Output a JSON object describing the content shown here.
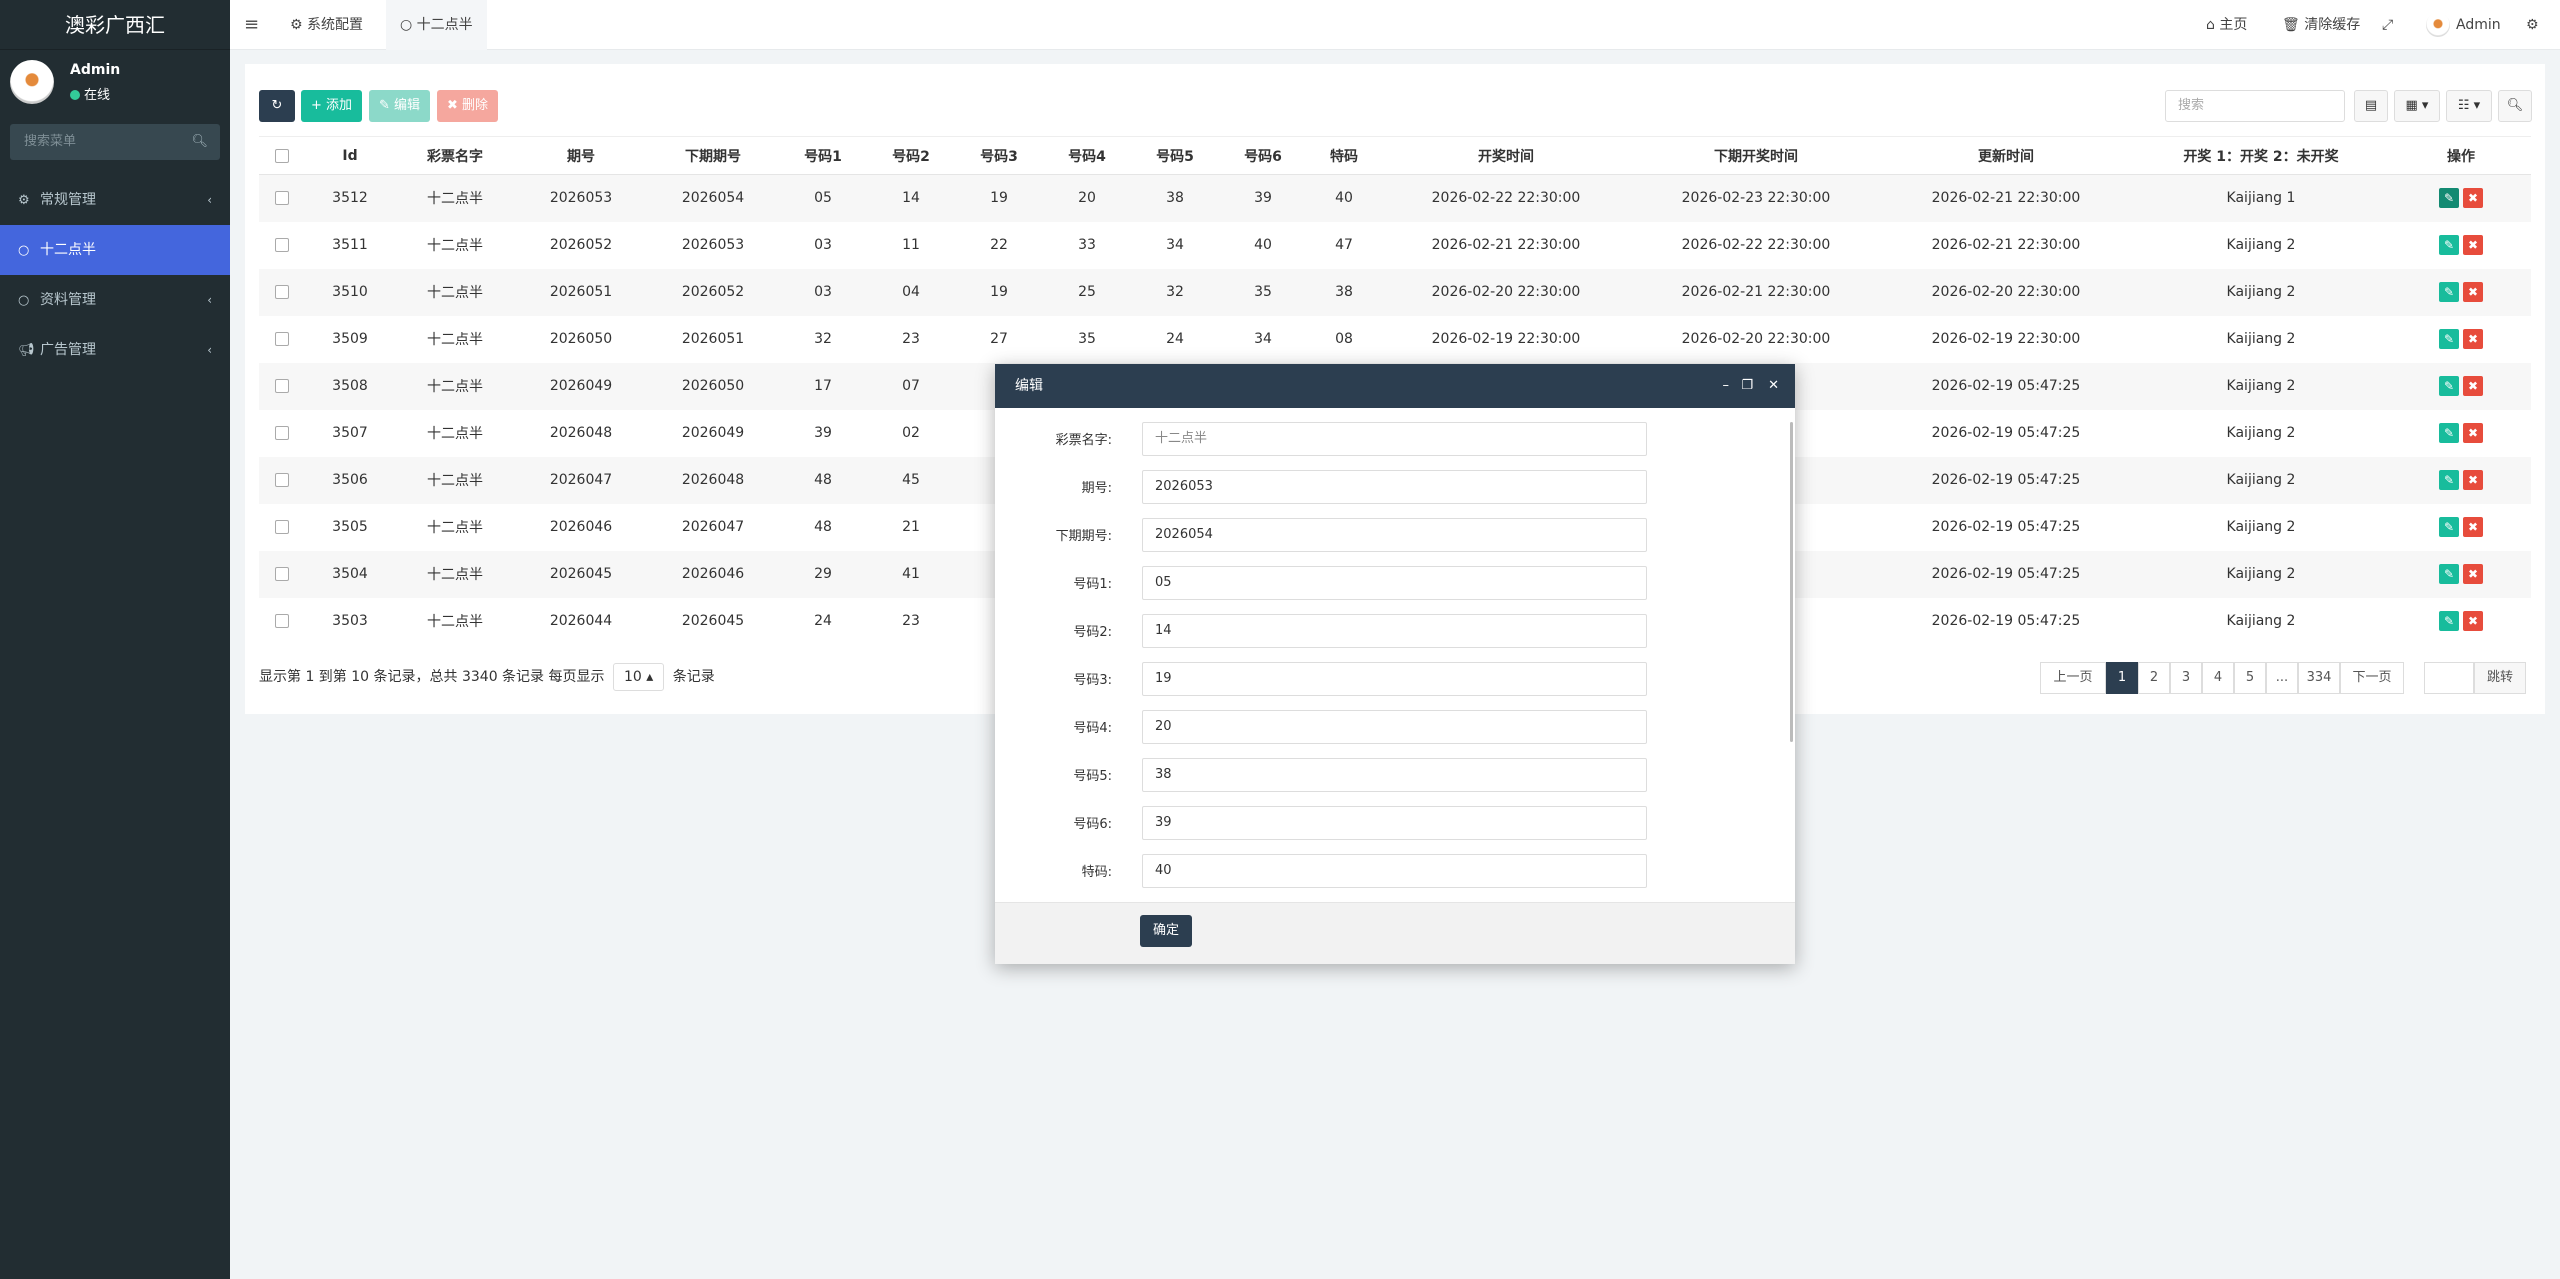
{
  "sidebar": {
    "logo": "澳彩广西汇",
    "user": {
      "name": "Admin",
      "status": "在线"
    },
    "search_placeholder": "搜索菜单",
    "items": [
      {
        "label": "常规管理",
        "icon": "gears-icon",
        "active": false,
        "expandable": true
      },
      {
        "label": "十二点半",
        "icon": "circle-icon",
        "active": true,
        "expandable": false
      },
      {
        "label": "资料管理",
        "icon": "circle-icon",
        "active": false,
        "expandable": true
      },
      {
        "label": "广告管理",
        "icon": "bullhorn-icon",
        "active": false,
        "expandable": true
      }
    ]
  },
  "topbar": {
    "tabs": [
      {
        "label": "系统配置",
        "icon": "gear-icon"
      },
      {
        "label": "十二点半",
        "icon": "circle-icon",
        "active": true
      }
    ],
    "home_label": "主页",
    "clear_cache_label": "清除缓存",
    "user_label": "Admin"
  },
  "toolbar": {
    "add_label": "添加",
    "edit_label": "编辑",
    "delete_label": "删除",
    "search_placeholder": "搜索"
  },
  "table": {
    "headers": [
      "Id",
      "彩票名字",
      "期号",
      "下期期号",
      "号码1",
      "号码2",
      "号码3",
      "号码4",
      "号码5",
      "号码6",
      "特码",
      "开奖时间",
      "下期开奖时间",
      "更新时间",
      "开奖 1：开奖 2：未开奖",
      "操作"
    ],
    "rows": [
      {
        "id": "3512",
        "name": "十二点半",
        "qh": "2026053",
        "next": "2026054",
        "n1": "05",
        "n2": "14",
        "n3": "19",
        "n4": "20",
        "n5": "38",
        "n6": "39",
        "tm": "40",
        "open": "2026-02-22 22:30:00",
        "next_open": "2026-02-23 22:30:00",
        "updated": "2026-02-21 22:30:00",
        "status": "Kaijiang 1"
      },
      {
        "id": "3511",
        "name": "十二点半",
        "qh": "2026052",
        "next": "2026053",
        "n1": "03",
        "n2": "11",
        "n3": "22",
        "n4": "33",
        "n5": "34",
        "n6": "40",
        "tm": "47",
        "open": "2026-02-21 22:30:00",
        "next_open": "2026-02-22 22:30:00",
        "updated": "2026-02-21 22:30:00",
        "status": "Kaijiang 2"
      },
      {
        "id": "3510",
        "name": "十二点半",
        "qh": "2026051",
        "next": "2026052",
        "n1": "03",
        "n2": "04",
        "n3": "19",
        "n4": "25",
        "n5": "32",
        "n6": "35",
        "tm": "38",
        "open": "2026-02-20 22:30:00",
        "next_open": "2026-02-21 22:30:00",
        "updated": "2026-02-20 22:30:00",
        "status": "Kaijiang 2"
      },
      {
        "id": "3509",
        "name": "十二点半",
        "qh": "2026050",
        "next": "2026051",
        "n1": "32",
        "n2": "23",
        "n3": "27",
        "n4": "35",
        "n5": "24",
        "n6": "34",
        "tm": "08",
        "open": "2026-02-19 22:30:00",
        "next_open": "2026-02-20 22:30:00",
        "updated": "2026-02-19 22:30:00",
        "status": "Kaijiang 2"
      },
      {
        "id": "3508",
        "name": "十二点半",
        "qh": "2026049",
        "next": "2026050",
        "n1": "17",
        "n2": "07",
        "n3": "",
        "n4": "",
        "n5": "",
        "n6": "",
        "tm": "",
        "open": "",
        "next_open": "2:30:00",
        "updated": "2026-02-19 05:47:25",
        "status": "Kaijiang 2"
      },
      {
        "id": "3507",
        "name": "十二点半",
        "qh": "2026048",
        "next": "2026049",
        "n1": "39",
        "n2": "02",
        "n3": "",
        "n4": "",
        "n5": "",
        "n6": "",
        "tm": "",
        "open": "",
        "next_open": "2:30:00",
        "updated": "2026-02-19 05:47:25",
        "status": "Kaijiang 2"
      },
      {
        "id": "3506",
        "name": "十二点半",
        "qh": "2026047",
        "next": "2026048",
        "n1": "48",
        "n2": "45",
        "n3": "",
        "n4": "",
        "n5": "",
        "n6": "",
        "tm": "",
        "open": "",
        "next_open": "2:30:00",
        "updated": "2026-02-19 05:47:25",
        "status": "Kaijiang 2"
      },
      {
        "id": "3505",
        "name": "十二点半",
        "qh": "2026046",
        "next": "2026047",
        "n1": "48",
        "n2": "21",
        "n3": "",
        "n4": "",
        "n5": "",
        "n6": "",
        "tm": "",
        "open": "",
        "next_open": "2:30:00",
        "updated": "2026-02-19 05:47:25",
        "status": "Kaijiang 2"
      },
      {
        "id": "3504",
        "name": "十二点半",
        "qh": "2026045",
        "next": "2026046",
        "n1": "29",
        "n2": "41",
        "n3": "",
        "n4": "",
        "n5": "",
        "n6": "",
        "tm": "",
        "open": "",
        "next_open": "2:30:00",
        "updated": "2026-02-19 05:47:25",
        "status": "Kaijiang 2"
      },
      {
        "id": "3503",
        "name": "十二点半",
        "qh": "2026044",
        "next": "2026045",
        "n1": "24",
        "n2": "23",
        "n3": "",
        "n4": "",
        "n5": "",
        "n6": "",
        "tm": "",
        "open": "",
        "next_open": "2:30:00",
        "updated": "2026-02-19 05:47:25",
        "status": "Kaijiang 2"
      }
    ]
  },
  "footer": {
    "info_prefix": "显示第 1 到第 10 条记录，总共 3340 条记录 每页显示",
    "page_size": "10",
    "info_suffix": "条记录"
  },
  "pagination": {
    "prev": "上一页",
    "pages": [
      "1",
      "2",
      "3",
      "4",
      "5",
      "...",
      "334"
    ],
    "active_page": "1",
    "next": "下一页",
    "jump": "跳转"
  },
  "modal": {
    "title": "编辑",
    "fields": [
      {
        "label": "彩票名字:",
        "value": "十二点半",
        "readonly": true
      },
      {
        "label": "期号:",
        "value": "2026053"
      },
      {
        "label": "下期期号:",
        "value": "2026054"
      },
      {
        "label": "号码1:",
        "value": "05"
      },
      {
        "label": "号码2:",
        "value": "14"
      },
      {
        "label": "号码3:",
        "value": "19"
      },
      {
        "label": "号码4:",
        "value": "20"
      },
      {
        "label": "号码5:",
        "value": "38"
      },
      {
        "label": "号码6:",
        "value": "39"
      },
      {
        "label": "特码:",
        "value": "40"
      }
    ],
    "confirm_label": "确定"
  },
  "colors": {
    "sidebar_bg": "#222d32",
    "active_menu": "#4466dd",
    "primary_dark": "#2c3e50",
    "success": "#18bc9c",
    "danger": "#e74c3c"
  }
}
